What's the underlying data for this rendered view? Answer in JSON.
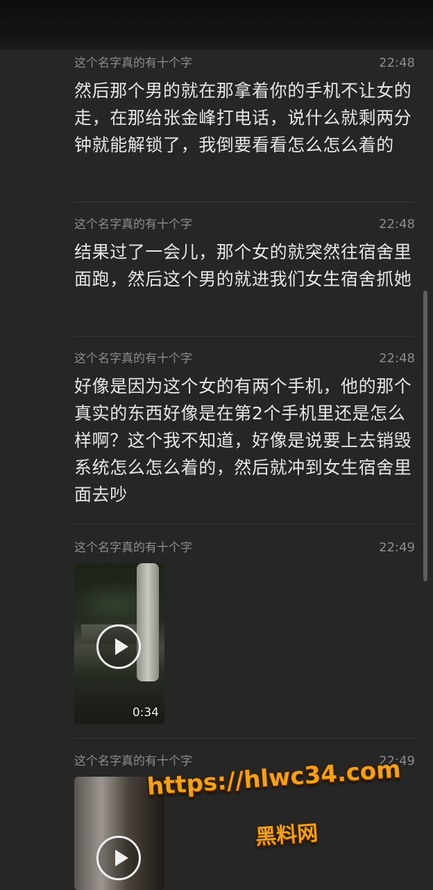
{
  "messages": [
    {
      "sender": "这个名字真的有十个字",
      "time": "22:48",
      "text": "然后那个男的就在那拿着你的手机不让女的走，在那给张金峰打电话，说什么就剩两分钟就能解锁了，我倒要看看怎么怎么着的"
    },
    {
      "sender": "这个名字真的有十个字",
      "time": "22:48",
      "text": "结果过了一会儿，那个女的就突然往宿舍里面跑，然后这个男的就进我们女生宿舍抓她"
    },
    {
      "sender": "这个名字真的有十个字",
      "time": "22:48",
      "text": "好像是因为这个女的有两个手机，他的那个真实的东西好像是在第2个手机里还是怎么样啊？这个我不知道，好像是说要上去销毁系统怎么怎么着的，然后就冲到女生宿舍里面去吵"
    },
    {
      "sender": "这个名字真的有十个字",
      "time": "22:49",
      "video_duration": "0:34"
    },
    {
      "sender": "这个名字真的有十个字",
      "time": "22:49"
    }
  ],
  "watermark": {
    "url": "https://hlwc34.com",
    "name": "黑料网"
  },
  "colors": {
    "background": "#262626",
    "text": "#e6e6e6",
    "meta": "#8c8c8c",
    "watermark": "#f0a020"
  },
  "icons": [
    "play-icon"
  ]
}
